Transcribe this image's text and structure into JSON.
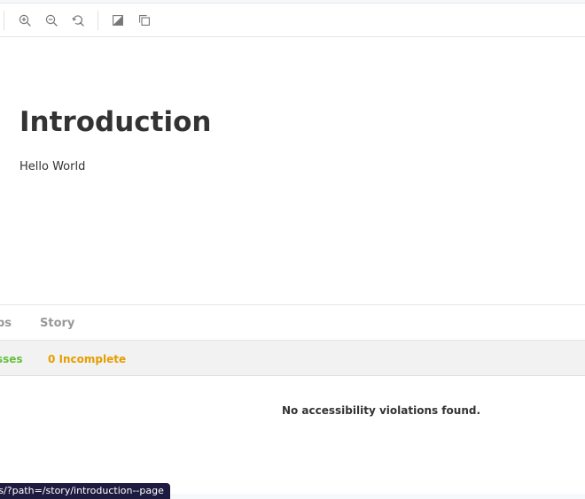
{
  "toolbar": {
    "zoom_in": "zoom-in-icon",
    "zoom_out": "zoom-out-icon",
    "zoom_reset": "zoom-reset-icon",
    "background": "background-toggle-icon",
    "grid": "outline-icon"
  },
  "preview": {
    "title": "Introduction",
    "text": "Hello World"
  },
  "panel": {
    "tabs": [
      {
        "label": "bs"
      },
      {
        "label": "Story"
      }
    ],
    "results": [
      {
        "label": "sses",
        "color": "#66bf3c"
      },
      {
        "label": "0 Incomplete",
        "color": "#e69d00"
      }
    ],
    "message": "No accessibility violations found."
  },
  "status": {
    "url": "ts/?path=/story/introduction--page"
  },
  "colors": {
    "passes": "#66bf3c",
    "incomplete": "#e69d00",
    "status_bg": "#1d1b3f"
  }
}
